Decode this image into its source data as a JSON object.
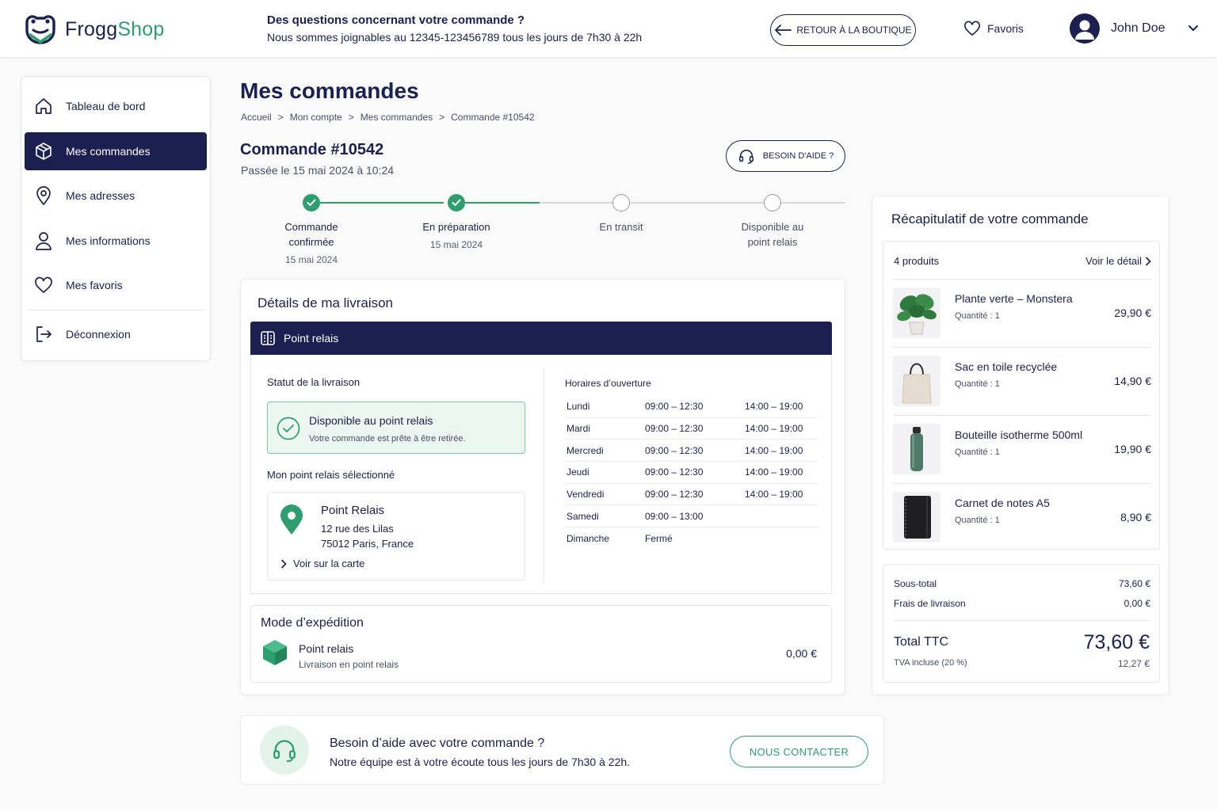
{
  "header": {
    "logo_part1": "Frogg",
    "logo_part2": "Shop",
    "question_title": "Des questions concernant votre commande ?",
    "question_text": "Nous sommes joignables au 12345-123456789 tous les jours de 7h30 à 22h",
    "back_button": "RETOUR À LA BOUTIQUE",
    "favorites": "Favoris",
    "user_name": "John Doe"
  },
  "sidebar": {
    "items": [
      {
        "label": "Tableau de bord",
        "icon": "home-icon"
      },
      {
        "label": "Mes commandes",
        "icon": "box-icon",
        "active": true
      },
      {
        "label": "Mes adresses",
        "icon": "location-pin-icon"
      },
      {
        "label": "Mes informations",
        "icon": "user-icon"
      },
      {
        "label": "Mes favoris",
        "icon": "heart-icon"
      }
    ],
    "logout": "Déconnexion"
  },
  "main": {
    "title": "Mes commandes",
    "breadcrumb": [
      "Accueil",
      "Mon compte",
      "Mes commandes",
      "Commande #10542"
    ],
    "breadcrumb_separator": ">",
    "order_title": "Commande #10542",
    "order_date": "Passée le 15 mai 2024 à 10:24",
    "help_button": "BESOIN D'AIDE ?"
  },
  "stepper": [
    {
      "line1": "Commande",
      "line2": "confirmée",
      "date": "15 mai 2024",
      "done": true
    },
    {
      "line1": "En préparation",
      "line2": "",
      "date": "15 mai 2024",
      "done": true
    },
    {
      "line1": "En transit",
      "line2": "",
      "date": "",
      "done": false
    },
    {
      "line1": "Disponible au",
      "line2": "point relais",
      "date": "",
      "done": false
    }
  ],
  "delivery": {
    "title": "Détails de ma livraison",
    "bar_label": "Point relais",
    "status_label": "Statut de la livraison",
    "status_title": "Disponible au point relais",
    "status_text": "Votre commande est prête à être retirée.",
    "selected_label": "Mon point relais sélectionné",
    "relay_name": "Point Relais",
    "relay_address1": "12 rue des Lilas",
    "relay_address2": "75012 Paris, France",
    "map_link": "Voir sur la carte",
    "hours_label": "Horaires d’ouverture",
    "hours": [
      {
        "day": "Lundi",
        "am": "09:00 – 12:30",
        "pm": "14:00 – 19:00"
      },
      {
        "day": "Mardi",
        "am": "09:00 – 12:30",
        "pm": "14:00 – 19:00"
      },
      {
        "day": "Mercredi",
        "am": "09:00 – 12:30",
        "pm": "14:00 – 19:00"
      },
      {
        "day": "Jeudi",
        "am": "09:00 – 12:30",
        "pm": "14:00 – 19:00"
      },
      {
        "day": "Vendredi",
        "am": "09:00 – 12:30",
        "pm": "14:00 – 19:00"
      },
      {
        "day": "Samedi",
        "am": "09:00 – 13:00",
        "pm": ""
      },
      {
        "day": "Dimanche",
        "am": "Fermé",
        "pm": ""
      }
    ]
  },
  "shipping": {
    "title": "Mode d’expédition",
    "name": "Point relais",
    "desc": "Livraison en point relais",
    "price": "0,00 €"
  },
  "summary": {
    "title": "Récapitulatif de votre commande",
    "count": "4 produits",
    "see_detail": "Voir le détail",
    "products": [
      {
        "name": "Plante verte – Monstera",
        "qty": "Quantité : 1",
        "price": "29,90 €",
        "icon": "plant-image"
      },
      {
        "name": "Sac en toile recyclée",
        "qty": "Quantité : 1",
        "price": "14,90 €",
        "icon": "tote-bag-image"
      },
      {
        "name": "Bouteille isotherme 500ml",
        "qty": "Quantité : 1",
        "price": "19,90 €",
        "icon": "bottle-image"
      },
      {
        "name": "Carnet de notes A5",
        "qty": "Quantité : 1",
        "price": "8,90 €",
        "icon": "notebook-image"
      }
    ],
    "subtotal_label": "Sous-total",
    "subtotal": "73,60 €",
    "shipping_label": "Frais de livraison",
    "shipping": "0,00 €",
    "total_label": "Total TTC",
    "total": "73,60 €",
    "tva_label": "TVA incluse (20 %)",
    "tva": "12,27 €"
  },
  "help": {
    "title": "Besoin d’aide avec votre commande ?",
    "text": "Notre équipe est à votre écoute tous les jours de 7h30 à 22h.",
    "button": "NOUS CONTACTER"
  },
  "colors": {
    "navy": "#1b2050",
    "green": "#2e9e6e",
    "light_green": "#ecf7f1"
  }
}
